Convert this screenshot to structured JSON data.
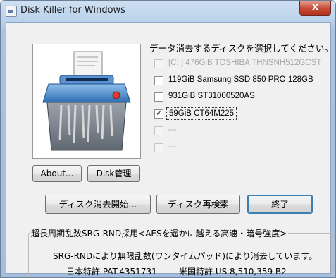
{
  "window": {
    "title": "Disk Killer for Windows",
    "close_label": "x"
  },
  "left_panel": {
    "illustration_icon": "paper-shredder-icon",
    "about_label": "About...",
    "disk_manager_label": "Disk管理"
  },
  "disks": {
    "prompt": "データ消去するディスクを選択してください。",
    "items": [
      {
        "label": "[C: ] 476GiB TOSHIBA THNSNH512GCST",
        "checked": false,
        "enabled": false
      },
      {
        "label": "119GiB Samsung SSD 850 PRO 128GB",
        "checked": false,
        "enabled": true
      },
      {
        "label": "931GiB ST31000520AS",
        "checked": false,
        "enabled": true
      },
      {
        "label": "59GiB CT64M225",
        "checked": true,
        "enabled": true
      },
      {
        "label": "---",
        "checked": false,
        "enabled": false
      },
      {
        "label": "---",
        "checked": false,
        "enabled": false
      }
    ]
  },
  "actions": {
    "start_label": "ディスク消去開始...",
    "rescan_label": "ディスク再検索",
    "exit_label": "終了"
  },
  "info": {
    "group_title": "超長周期乱数SRG-RND採用<AESを遥かに越える高速・暗号強度>",
    "line1": "SRG-RNDにより無限乱数(ワンタイムパッド)により消去しています。",
    "patent_jp": "日本特許 PAT.4351731",
    "patent_us": "米国特許 US 8,510,359 B2"
  },
  "colors": {
    "title_bar": "#b9d1ea",
    "close_button": "#c54b34",
    "dialog_background": "#f0f0f0"
  }
}
